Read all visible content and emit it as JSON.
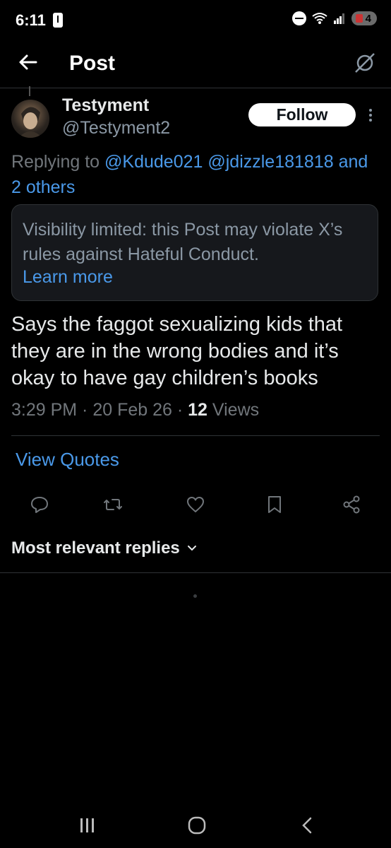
{
  "status_bar": {
    "time": "6:11",
    "battery": "4"
  },
  "header": {
    "title": "Post"
  },
  "author": {
    "name": "Testyment",
    "handle": "@Testyment2",
    "follow_label": "Follow"
  },
  "replying": {
    "prefix": "Replying to ",
    "mentions": "@Kdude021 @jdizzle181818 and",
    "others": "2 others"
  },
  "notice": {
    "text": "Visibility limited: this Post may violate X’s rules against Hateful Conduct.",
    "link": "Learn more"
  },
  "post": {
    "text": "Says the faggot sexualizing kids that they are in the wrong bodies and it’s okay to have gay children’s books",
    "time": "3:29 PM",
    "date": "20 Feb 26",
    "views_count": "12",
    "views_label": "Views",
    "sep": " · "
  },
  "view_quotes": "View Quotes",
  "replies_sort": {
    "label": "Most relevant replies"
  },
  "icons": {
    "back": "arrow-left-icon",
    "grok": "grok-icon",
    "reply": "reply-icon",
    "repost": "repost-icon",
    "like": "heart-icon",
    "bookmark": "bookmark-icon",
    "share": "share-icon"
  },
  "colors": {
    "accent": "#4a99e9",
    "background": "#000000",
    "muted": "#71767b"
  }
}
